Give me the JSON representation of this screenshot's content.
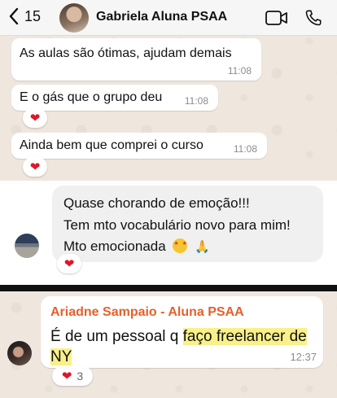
{
  "header": {
    "back_count": "15",
    "contact_name": "Gabriela Aluna PSAA"
  },
  "messages_top": [
    {
      "text": "As aulas são ótimas, ajudam demais",
      "time": "11:08",
      "reaction": ""
    },
    {
      "text": "E o gás que o grupo deu",
      "time": "11:08",
      "reaction": "❤"
    },
    {
      "text": "Ainda bem que comprei o curso",
      "time": "11:08",
      "reaction": "❤"
    }
  ],
  "message_mid": {
    "lines": [
      "Quase chorando de emoção!!!",
      "Tem mto vocabulário novo para mim!",
      "Mto emocionada"
    ],
    "reaction": "❤"
  },
  "message_bottom": {
    "sender": "Ariadne Sampaio - Aluna PSAA",
    "line1_plain": "É de um pessoal q ",
    "line1_highlight": "faço freelancer de",
    "line2_highlight": "NY",
    "time": "12:37",
    "reaction": "❤",
    "reaction_count": "3"
  },
  "icons": {
    "back": "chevron-left-icon",
    "video": "video-call-icon",
    "phone": "phone-call-icon"
  },
  "colors": {
    "chat_background": "#efe7de",
    "header_background": "#f6f6f6",
    "sender_name": "#e5602c",
    "highlight": "#f9f08a",
    "heart": "#e0152b"
  }
}
